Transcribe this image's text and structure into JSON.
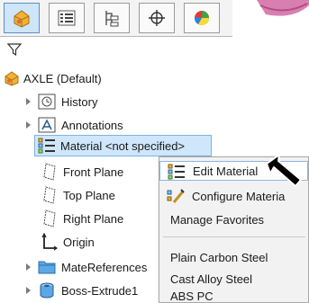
{
  "tabs": [
    {
      "name": "featuremanager-tab",
      "icon": "featuremanager-icon"
    },
    {
      "name": "propertymanager-tab",
      "icon": "propertymanager-icon"
    },
    {
      "name": "configurationmanager-tab",
      "icon": "configurationmanager-icon"
    },
    {
      "name": "dimxpertmanager-tab",
      "icon": "dimxpert-icon"
    },
    {
      "name": "displaymanager-tab",
      "icon": "displaymanager-icon"
    }
  ],
  "tree": {
    "root": "AXLE  (Default)",
    "items": [
      {
        "label": "History",
        "icon": "history-folder-icon"
      },
      {
        "label": "Annotations",
        "icon": "annotations-folder-icon"
      },
      {
        "label": "Material <not specified>",
        "icon": "material-icon"
      },
      {
        "label": "Front Plane",
        "icon": "plane-icon"
      },
      {
        "label": "Top Plane",
        "icon": "plane-icon"
      },
      {
        "label": "Right Plane",
        "icon": "plane-icon"
      },
      {
        "label": "Origin",
        "icon": "origin-icon"
      },
      {
        "label": "MateReferences",
        "icon": "mate-references-folder-icon"
      },
      {
        "label": "Boss-Extrude1",
        "icon": "extrude-icon"
      }
    ]
  },
  "context_menu": {
    "items": [
      {
        "label": "Edit Material",
        "icon": "edit-material-icon"
      },
      {
        "label": "Configure Materia",
        "icon": "configure-material-icon"
      },
      {
        "label": "Manage Favorites"
      },
      {
        "label": "Plain Carbon Steel"
      },
      {
        "label": "Cast Alloy Steel"
      },
      {
        "label": "ABS PC"
      }
    ]
  },
  "colors": {
    "selection": "#cfe6fb",
    "folder": "#5aa9e6",
    "part": "#f2b233",
    "accent": "#d97fb0"
  }
}
